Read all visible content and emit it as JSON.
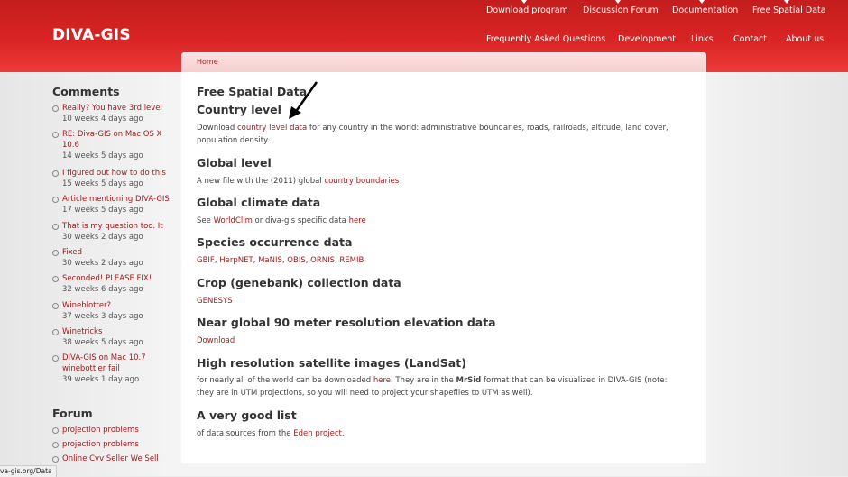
{
  "site": {
    "logo": "DIVA-GIS"
  },
  "nav": {
    "top": [
      {
        "label": "Download program"
      },
      {
        "label": "Discussion Forum"
      },
      {
        "label": "Documentation"
      },
      {
        "label": "Free Spatial Data"
      }
    ],
    "bottom": [
      {
        "label": "Frequently Asked Questions"
      },
      {
        "label": "Development"
      },
      {
        "label": "Links"
      },
      {
        "label": "Contact"
      },
      {
        "label": "About us"
      }
    ]
  },
  "breadcrumb": {
    "home": "Home"
  },
  "main": {
    "title": "Free Spatial Data",
    "sections": [
      {
        "heading": "Country level",
        "pre": "Download ",
        "link": "country level data",
        "post": " for any country in the world: administrative boundaries, roads, railroads, altitude, land cover, population density."
      },
      {
        "heading": "Global level",
        "pre": "A new file with the (2011) global ",
        "link": "country boundaries"
      },
      {
        "heading": "Global climate data",
        "pre": "See ",
        "link1": "WorldClim",
        "mid": " or diva-gis specific data ",
        "link2": "here"
      },
      {
        "heading": "Species occurrence data",
        "links": [
          "GBIF",
          "HerpNET",
          "MaNIS",
          "OBIS",
          "ORNIS",
          "REMIB"
        ],
        "sep": ", "
      },
      {
        "heading": "Crop (genebank) collection data",
        "link": "GENESYS"
      },
      {
        "heading": "Near global 90 meter resolution elevation data",
        "link": "Download"
      },
      {
        "heading": "High resolution satellite images (LandSat)",
        "pre": "for nearly all of the world can be downloaded ",
        "link": "here",
        "mid": ". They are in the ",
        "bold": "MrSid",
        "post": " format that can be visualized in DIVA-GIS (note: they are in UTM projections, so you will need to project your shapefiles to UTM as well)."
      },
      {
        "heading": "A very good list",
        "pre": "of data sources from the ",
        "link": "Eden project",
        "post": "."
      }
    ]
  },
  "sidebar": {
    "comments_heading": "Comments",
    "comments": [
      {
        "title": "Really? You have 3rd level",
        "age": "10 weeks 4 days ago"
      },
      {
        "title": "RE: Diva-GIS on Mac OS X 10.6",
        "age": "14 weeks 5 days ago"
      },
      {
        "title": "I figured out how to do this",
        "age": "15 weeks 5 days ago"
      },
      {
        "title": "Article mentioning DIVA-GIS",
        "age": "17 weeks 5 days ago"
      },
      {
        "title": "That is my question too. It",
        "age": "30 weeks 2 days ago"
      },
      {
        "title": "Fixed",
        "age": "30 weeks 2 days ago"
      },
      {
        "title": "Seconded! PLEASE FIX!",
        "age": "32 weeks 6 days ago"
      },
      {
        "title": "Wineblotter?",
        "age": "37 weeks 3 days ago"
      },
      {
        "title": "Winetricks",
        "age": "38 weeks 5 days ago"
      },
      {
        "title": "DIVA-GIS on Mac 10.7 winebottler fail",
        "age": "39 weeks 1 day ago"
      }
    ],
    "forum_heading": "Forum",
    "forum": [
      {
        "title": "projection problems"
      },
      {
        "title": "projection problems"
      },
      {
        "title": "Online Cvv Seller We Sell"
      }
    ]
  },
  "statusbar": {
    "text": "va-gis.org/Data"
  },
  "colors": {
    "header": "#d92424",
    "link": "#a11b1b",
    "text": "#444444"
  }
}
